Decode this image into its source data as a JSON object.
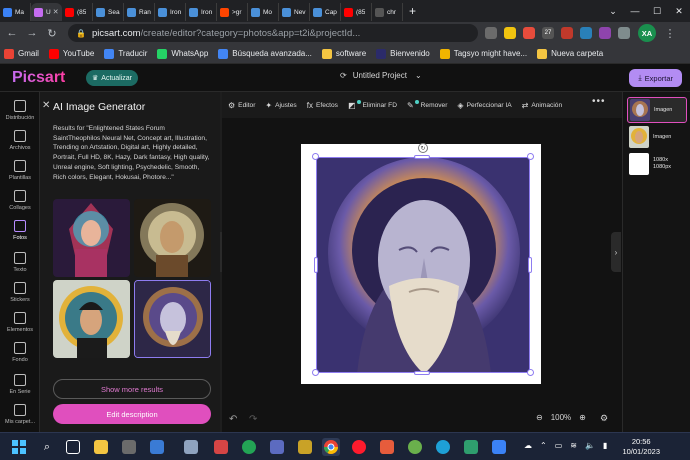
{
  "browser": {
    "tabs": [
      {
        "label": "Ma",
        "color": "#3b82f6",
        "icon": "star-icon"
      },
      {
        "label": "U",
        "color": "#c56cf0",
        "icon": "picsart-icon",
        "active": true
      },
      {
        "label": "(85",
        "color": "#ff0000",
        "icon": "youtube-icon"
      },
      {
        "label": "Sea",
        "color": "#4a90d9",
        "icon": "doc-icon"
      },
      {
        "label": "Ran",
        "color": "#4a90d9",
        "icon": "doc-icon"
      },
      {
        "label": "Iron",
        "color": "#4a90d9",
        "icon": "doc-icon"
      },
      {
        "label": "Iron",
        "color": "#4a90d9",
        "icon": "doc-icon"
      },
      {
        "label": ">gr",
        "color": "#ff4500",
        "icon": "reddit-icon"
      },
      {
        "label": "Mo",
        "color": "#4a90d9",
        "icon": "doc-icon"
      },
      {
        "label": "Nev",
        "color": "#4a90d9",
        "icon": "doc-icon"
      },
      {
        "label": "Cap",
        "color": "#4a90d9",
        "icon": "doc-icon"
      },
      {
        "label": "(85",
        "color": "#ff0000",
        "icon": "youtube-icon"
      },
      {
        "label": "chr",
        "color": "#555555",
        "icon": "chrome-icon"
      }
    ],
    "new_tab": "+",
    "window_controls": [
      "⌄",
      "—",
      "☐",
      "✕"
    ],
    "url_host": "picsart.com",
    "url_path": "/create/editor?category=photos&app=t2i&projectId...",
    "extension_badge": "27",
    "profile": "XA",
    "bookmarks": [
      {
        "label": "Gmail",
        "color": "#ea4335",
        "icon": "gmail-icon"
      },
      {
        "label": "YouTube",
        "color": "#ff0000",
        "icon": "youtube-icon"
      },
      {
        "label": "Traducir",
        "color": "#4285f4",
        "icon": "translate-icon"
      },
      {
        "label": "WhatsApp",
        "color": "#25d366",
        "icon": "whatsapp-icon"
      },
      {
        "label": "Búsqueda avanzada...",
        "color": "#4285f4",
        "icon": "google-icon"
      },
      {
        "label": "software",
        "color": "#f4c542",
        "icon": "folder-icon"
      },
      {
        "label": "Bienvenido",
        "color": "#2b2b6a",
        "icon": "c-icon"
      },
      {
        "label": "Tagsyo might have...",
        "color": "#f0b400",
        "icon": "tag-icon"
      },
      {
        "label": "Nueva carpeta",
        "color": "#f4c542",
        "icon": "folder-icon"
      }
    ]
  },
  "app": {
    "logo": "Picsart",
    "upgrade": "Actualizar",
    "project_title": "Untitled Project",
    "export": "Exportar",
    "rail": [
      {
        "label": "Distribución",
        "icon": "layout-icon"
      },
      {
        "label": "Archivos",
        "icon": "upload-icon"
      },
      {
        "label": "Plantillas",
        "icon": "templates-icon"
      },
      {
        "label": "Collages",
        "icon": "collage-icon"
      },
      {
        "label": "Fotos",
        "icon": "photos-icon",
        "active": true
      },
      {
        "label": "Texto",
        "icon": "text-icon"
      },
      {
        "label": "Stickers",
        "icon": "sticker-icon"
      },
      {
        "label": "Elementos",
        "icon": "elements-icon"
      },
      {
        "label": "Fondo",
        "icon": "background-icon"
      },
      {
        "label": "En Serie",
        "icon": "batch-icon"
      },
      {
        "label": "Mis carpet...",
        "icon": "folder-icon"
      }
    ],
    "panel": {
      "title": "AI Image Generator",
      "results": "Results for \"Enlightened States Forum SaintTheophilos Neural Net, Concept art, Illustration, Trending on Artstation, Digital art, Highly detailed, Portrait, Full HD, 8K, Hazy, Dark fantasy, High quality, Unreal engine, Soft lighting, Psychedelic, Smooth, Rich colors, Elegant, Hokusai, Photore...\"",
      "show_more": "Show more results",
      "edit_description": "Edit description"
    },
    "toolbar": [
      {
        "label": "Editor",
        "icon": "sliders-icon"
      },
      {
        "label": "Ajustes",
        "icon": "adjust-icon"
      },
      {
        "label": "Efectos",
        "icon": "fx-icon"
      },
      {
        "label": "Eliminar FD",
        "icon": "remove-bg-icon",
        "badge": true
      },
      {
        "label": "Remover",
        "icon": "eraser-icon",
        "badge": true
      },
      {
        "label": "Perfeccionar IA",
        "icon": "enhance-icon"
      },
      {
        "label": "Animación",
        "icon": "animation-icon"
      }
    ],
    "zoom": "100%",
    "layers": [
      {
        "label": "Imagen"
      },
      {
        "label": "Imagen"
      },
      {
        "label": "1080x\n1080px"
      }
    ]
  },
  "taskbar": {
    "time": "20:56",
    "date": "10/01/2023"
  },
  "colors": {
    "accent": "#c56cf0",
    "pink_button": "#e04fbe",
    "export": "#b38cf3",
    "selection": "#8e7cf0"
  }
}
